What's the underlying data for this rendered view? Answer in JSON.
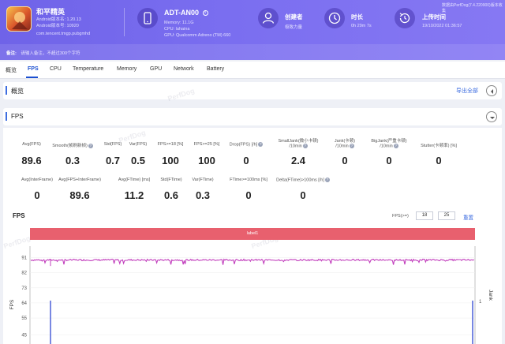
{
  "app": {
    "name": "和平精英",
    "version_name": "Android版本名: 1.20.13",
    "version_code": "Android版本号: 10920",
    "package": "com.tencent.tmgp.pubgmhd"
  },
  "device": {
    "name": "ADT-AN00",
    "info_glyph": "i",
    "memory": "Memory: 11.1G",
    "cpu": "CPU: lahaina",
    "gpu": "GPU: Qualcomm Adreno (TM) 660"
  },
  "creator": {
    "title": "创建者",
    "value": "极致力量"
  },
  "duration": {
    "title": "时长",
    "value": "0h 29m 7s"
  },
  "upload": {
    "title": "上传时间",
    "value": "19/10/2022 01:36:57"
  },
  "right_note": "数据由PerfDog(7.4.220900)版本收集",
  "notice": {
    "label": "备注:",
    "text": "请输入备注，不超过300个字符"
  },
  "tabs": [
    "概览",
    "FPS",
    "CPU",
    "Temperature",
    "Memory",
    "GPU",
    "Network",
    "Battery"
  ],
  "overview": {
    "title": "概览",
    "export": "导出全部"
  },
  "fps_section": {
    "title": "FPS"
  },
  "metrics_row1": [
    {
      "label": "Avg(FPS)",
      "value": "89.6",
      "help": false
    },
    {
      "label": "Smooth(帧刷新帧)",
      "value": "0.3",
      "help": true
    },
    {
      "label": "Std(FPS)",
      "value": "0.7",
      "help": false
    },
    {
      "label": "Var(FPS)",
      "value": "0.5",
      "help": false
    },
    {
      "label": "FPS>=18 [%]",
      "value": "100",
      "help": false
    },
    {
      "label": "FPS>=25 [%]",
      "value": "100",
      "help": false
    },
    {
      "label": "Drop(FPS) [/h]",
      "value": "0",
      "help": true
    },
    {
      "label": "SmallJank(微小卡顿)\n/10min",
      "value": "2.4",
      "help": true
    },
    {
      "label": "Jank(卡顿)\n/10min",
      "value": "0",
      "help": true
    },
    {
      "label": "BigJank(严重卡顿)\n/10min",
      "value": "0",
      "help": true
    },
    {
      "label": "Stutter(卡顿率) [%]",
      "value": "0",
      "help": false
    }
  ],
  "metrics_row2": [
    {
      "label": "Avg(InterFrame)",
      "value": "0",
      "help": false
    },
    {
      "label": "Avg(FPS+InterFrame)",
      "value": "89.6",
      "help": false
    },
    {
      "label": "Avg(FTime) [ms]",
      "value": "11.2",
      "help": false
    },
    {
      "label": "Std(FTime)",
      "value": "0.6",
      "help": false
    },
    {
      "label": "Var(FTime)",
      "value": "0.3",
      "help": false
    },
    {
      "label": "FTime>=100ms [%]",
      "value": "0",
      "help": false
    },
    {
      "label": "Delta(FTime)>100ms [/h]",
      "value": "0",
      "help": true
    }
  ],
  "chart": {
    "title": "FPS",
    "threshold_label": "FPS(>=)",
    "threshold_1": "18",
    "threshold_2": "25",
    "reset": "重置",
    "label_bar": "label1",
    "watermark": "PerfDog"
  },
  "chart_data": {
    "type": "line",
    "title": "FPS",
    "ylabel": "FPS",
    "y2label": "Jank",
    "yticks": [
      91,
      82,
      73,
      64,
      55,
      45
    ],
    "y2ticks": [
      1
    ],
    "ylim": [
      40,
      95
    ],
    "series": [
      {
        "name": "FPS",
        "color": "#c23fbd",
        "approx_value": 89.6
      },
      {
        "name": "Jank",
        "color": "#3f54d6",
        "spikes": [
          1,
          1
        ]
      }
    ]
  }
}
